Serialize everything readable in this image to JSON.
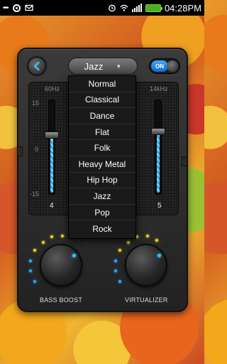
{
  "status_bar": {
    "time": "04:28PM",
    "icons": [
      "dots-icon",
      "ring-icon",
      "mail-icon",
      "alarm-icon",
      "wifi-icon",
      "signal-icon",
      "battery-icon"
    ]
  },
  "header": {
    "preset_label": "Jazz",
    "toggle_label": "ON"
  },
  "eq": {
    "db_labels": [
      "15",
      "0",
      "-15"
    ],
    "bands": [
      {
        "freq": "60Hz",
        "value": "4",
        "level": 0.63
      },
      {
        "freq": "14kHz",
        "value": "5",
        "level": 0.67
      }
    ]
  },
  "knobs": [
    {
      "label": "BASS BOOST"
    },
    {
      "label": "VIRTUALIZER"
    }
  ],
  "dropdown": {
    "items": [
      "Normal",
      "Classical",
      "Dance",
      "Flat",
      "Folk",
      "Heavy Metal",
      "Hip Hop",
      "Jazz",
      "Pop",
      "Rock"
    ]
  },
  "colors": {
    "accent": "#2aa7e6",
    "led_yellow": "#f3d021",
    "toggle_on": "#1f86e8"
  }
}
